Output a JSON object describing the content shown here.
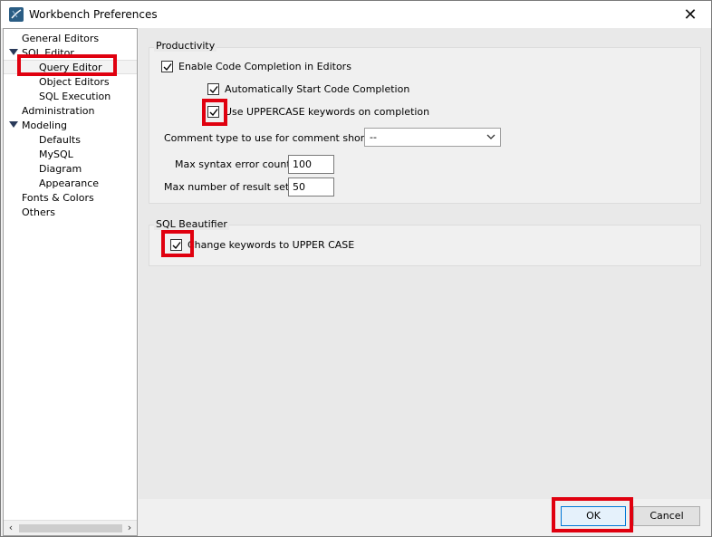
{
  "window": {
    "title": "Workbench Preferences"
  },
  "tree": {
    "items": [
      {
        "label": "General Editors"
      },
      {
        "label": "SQL Editor"
      },
      {
        "label": "Query Editor"
      },
      {
        "label": "Object Editors"
      },
      {
        "label": "SQL Execution"
      },
      {
        "label": "Administration"
      },
      {
        "label": "Modeling"
      },
      {
        "label": "Defaults"
      },
      {
        "label": "MySQL"
      },
      {
        "label": "Diagram"
      },
      {
        "label": "Appearance"
      },
      {
        "label": "Fonts & Colors"
      },
      {
        "label": "Others"
      }
    ]
  },
  "productivity": {
    "title": "Productivity",
    "enable_completion": {
      "label": "Enable Code Completion in Editors",
      "checked": true
    },
    "auto_start": {
      "label": "Automatically Start Code Completion",
      "checked": true
    },
    "uppercase": {
      "label": "Use UPPERCASE keywords on completion",
      "checked": true
    },
    "comment_type_label": "Comment type to use for comment shortcut:",
    "comment_type_value": "--",
    "max_syntax_label": "Max syntax error count:",
    "max_syntax_value": "100",
    "max_results_label": "Max number of result sets:",
    "max_results_value": "50"
  },
  "beautifier": {
    "title": "SQL Beautifier",
    "change_keywords": {
      "label": "Change keywords to UPPER CASE",
      "checked": true
    }
  },
  "buttons": {
    "ok": "OK",
    "cancel": "Cancel"
  },
  "colors": {
    "highlight": "#e0000f",
    "primary_border": "#0078d7"
  }
}
